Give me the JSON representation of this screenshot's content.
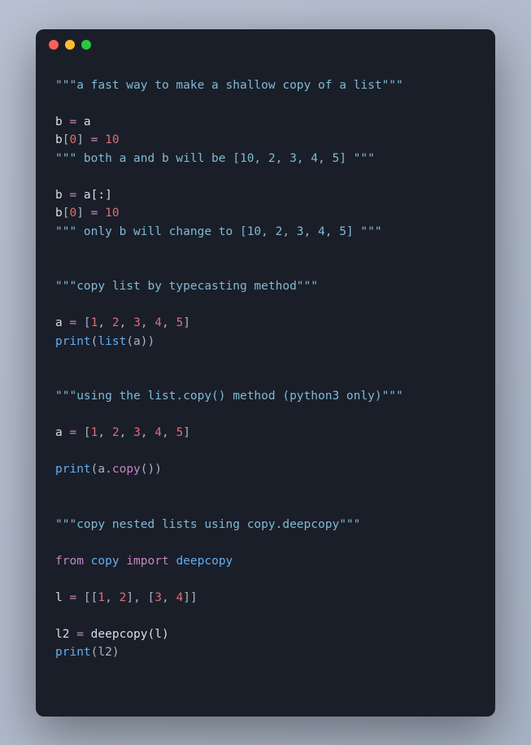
{
  "code": {
    "l01a": "\"\"\"a fast way to make a shallow copy of a list\"\"\"",
    "l03a": "b ",
    "l03b": "=",
    "l03c": " a",
    "l04a": "b",
    "l04b": "[",
    "l04c": "0",
    "l04d": "] ",
    "l04e": "=",
    "l04f": " ",
    "l04g": "10",
    "l05a": "\"\"\" both a and b will be [10, 2, 3, 4, 5] \"\"\"",
    "l07a": "b ",
    "l07b": "=",
    "l07c": " a[:]",
    "l08a": "b",
    "l08b": "[",
    "l08c": "0",
    "l08d": "] ",
    "l08e": "=",
    "l08f": " ",
    "l08g": "10",
    "l09a": "\"\"\" only b will change to [10, 2, 3, 4, 5] \"\"\"",
    "l12a": "\"\"\"copy list by typecasting method\"\"\"",
    "l14a": "a ",
    "l14b": "=",
    "l14c": " [",
    "l14d": "1",
    "l14e": ", ",
    "l14f": "2",
    "l14g": ", ",
    "l14h": "3",
    "l14i": ", ",
    "l14j": "4",
    "l14k": ", ",
    "l14l": "5",
    "l14m": "]",
    "l15a": "print",
    "l15b": "(",
    "l15c": "list",
    "l15d": "(a))",
    "l18a": "\"\"\"using the list.copy() method (python3 only)\"\"\"",
    "l20a": "a ",
    "l20b": "=",
    "l20c": " [",
    "l20d": "1",
    "l20e": ", ",
    "l20f": "2",
    "l20g": ", ",
    "l20h": "3",
    "l20i": ", ",
    "l20j": "4",
    "l20k": ", ",
    "l20l": "5",
    "l20m": "]",
    "l22a": "print",
    "l22b": "(a.",
    "l22c": "copy",
    "l22d": "())",
    "l25a": "\"\"\"copy nested lists using copy.deepcopy\"\"\"",
    "l27a": "from",
    "l27b": " ",
    "l27c": "copy",
    "l27d": " ",
    "l27e": "import",
    "l27f": " ",
    "l27g": "deepcopy",
    "l29a": "l ",
    "l29b": "=",
    "l29c": " [[",
    "l29d": "1",
    "l29e": ", ",
    "l29f": "2",
    "l29g": "], [",
    "l29h": "3",
    "l29i": ", ",
    "l29j": "4",
    "l29k": "]]",
    "l31a": "l2 ",
    "l31b": "=",
    "l31c": " deepcopy(l)",
    "l32a": "print",
    "l32b": "(l2)"
  }
}
